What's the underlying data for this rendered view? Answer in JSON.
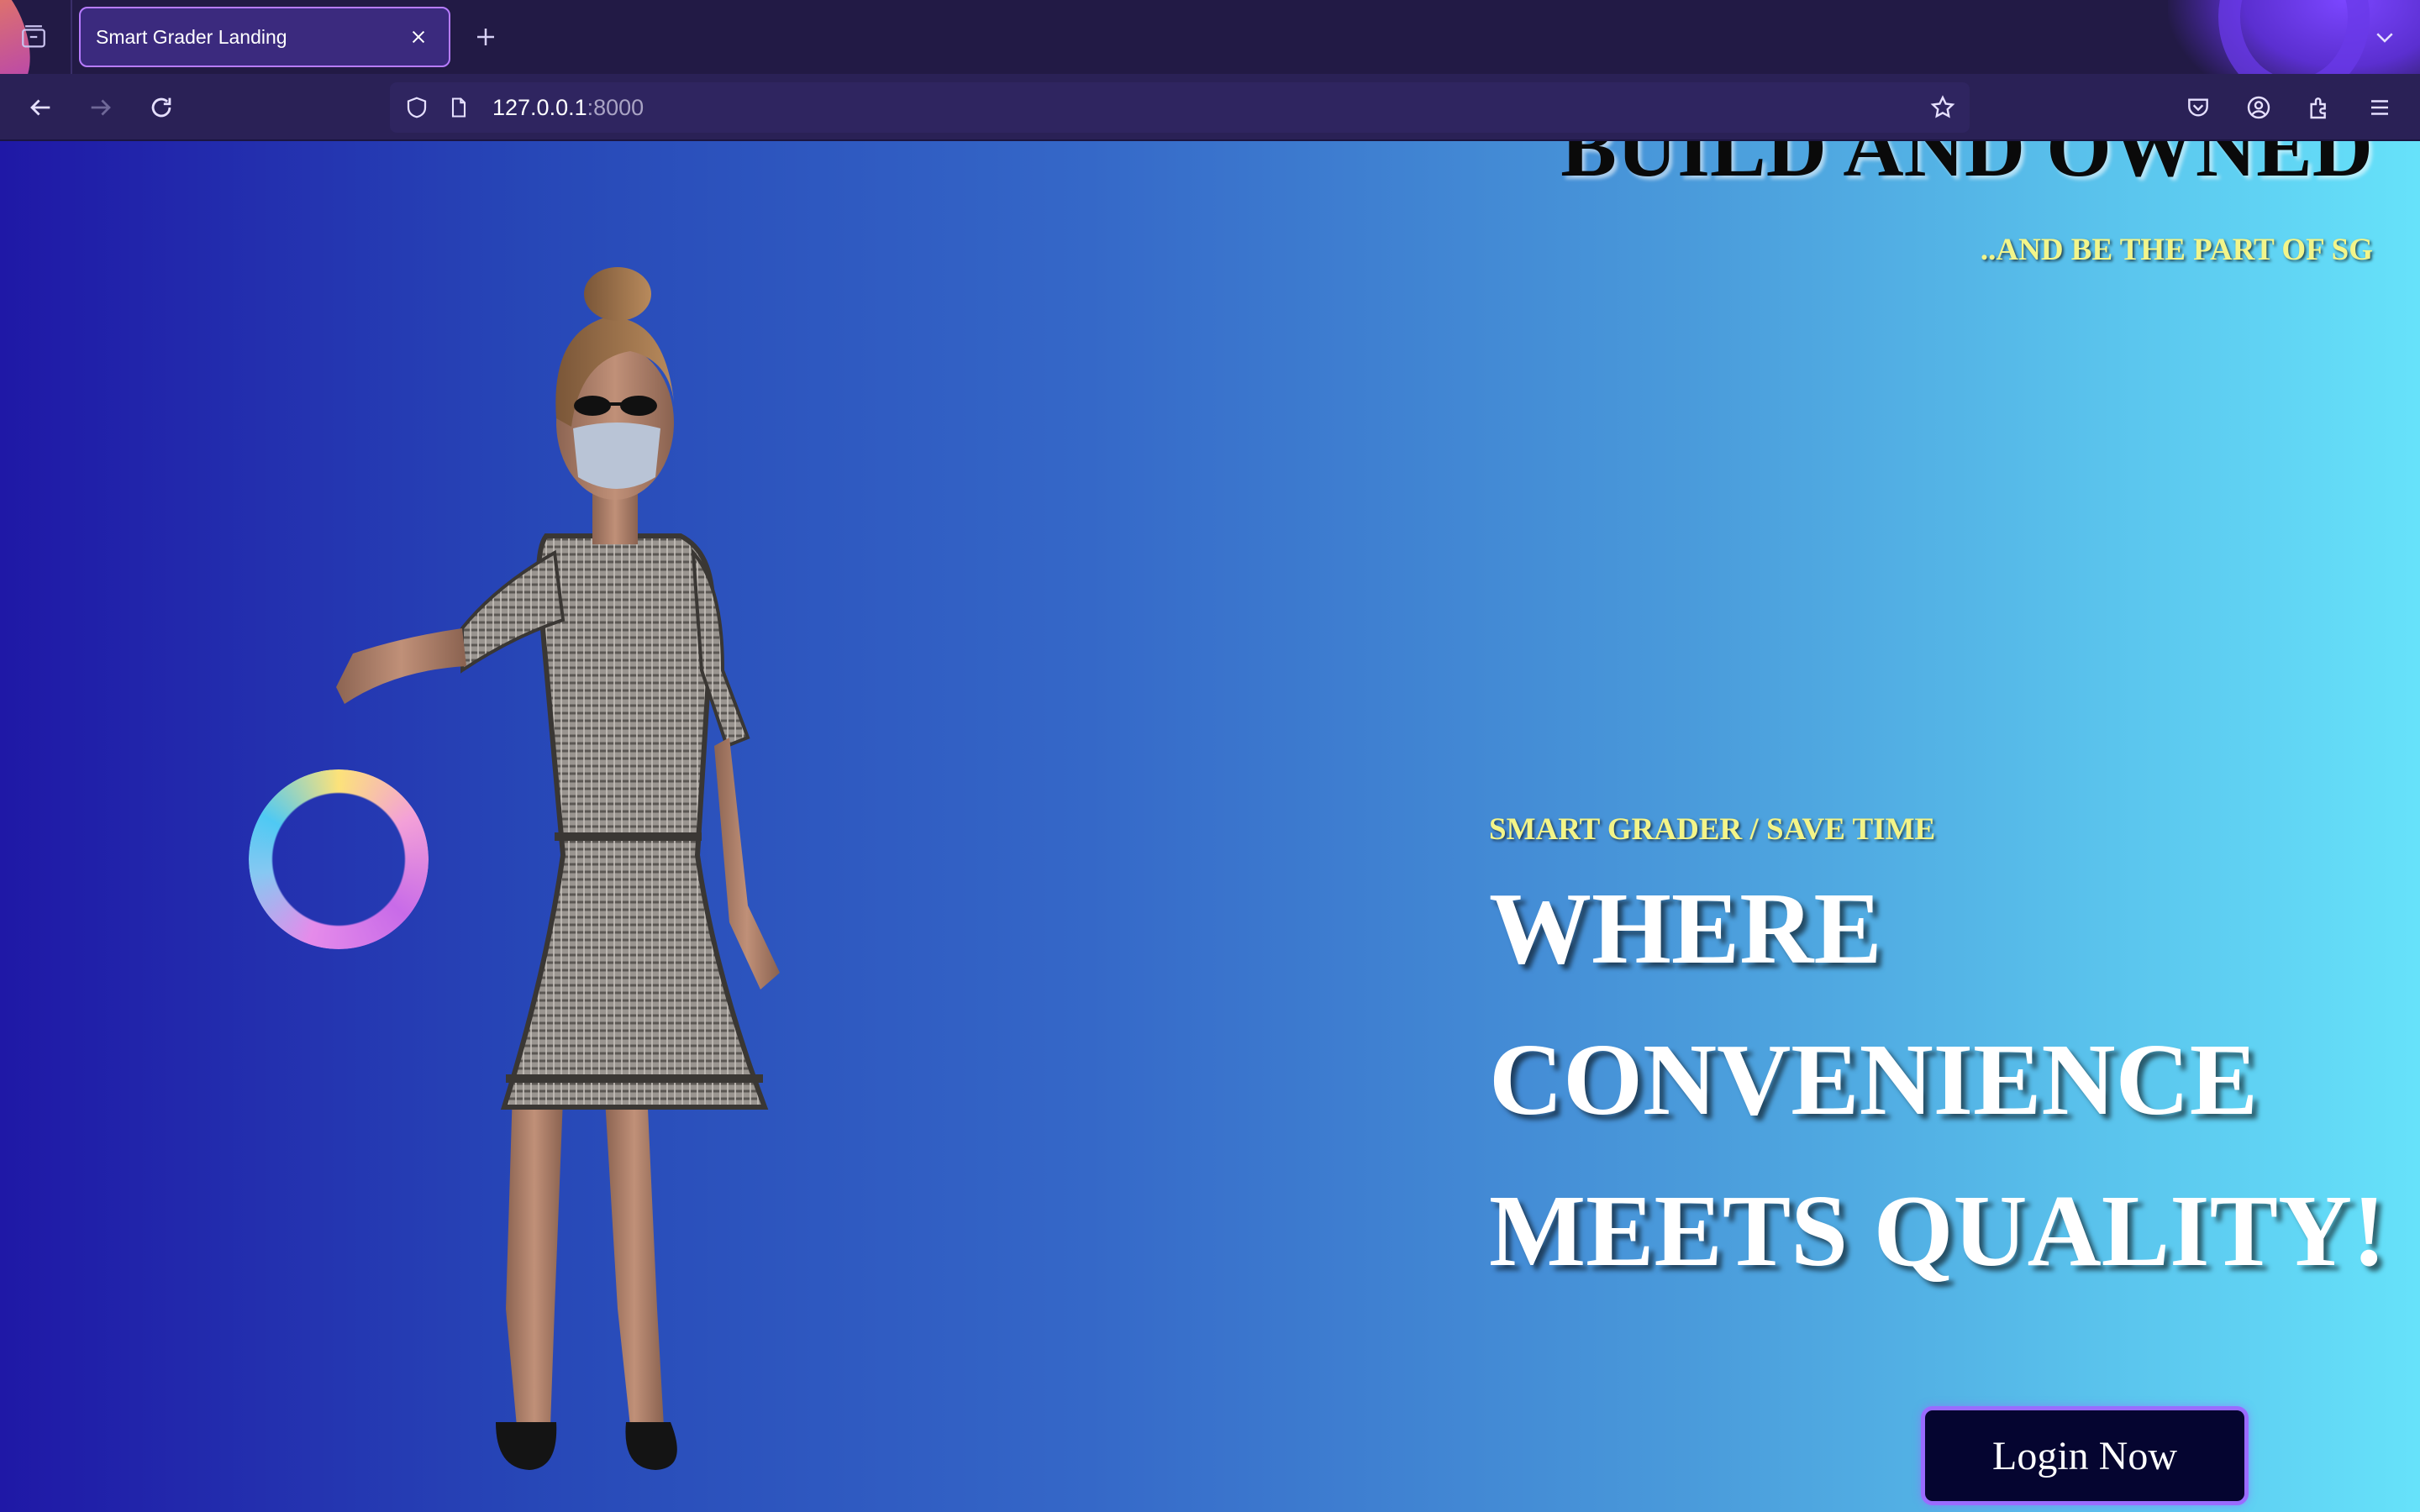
{
  "browser": {
    "tab": {
      "title": "Smart Grader Landing"
    },
    "url": {
      "host": "127.0.0.1",
      "port": ":8000"
    }
  },
  "page": {
    "hero_heading": "BUILD AND OWNED",
    "hero_subheading": "..AND BE THE PART OF SG",
    "tagline": "SMART GRADER / SAVE TIME",
    "headline_lines": [
      "WHERE",
      "CONVENIENCE",
      "MEETS QUALITY!"
    ],
    "login_button": "Login Now"
  },
  "icons": {
    "tab_list": "tab-list-icon",
    "tab_close": "close-icon",
    "new_tab": "plus-icon",
    "tab_overflow": "chevron-down-icon",
    "back": "back-arrow-icon",
    "forward": "forward-arrow-icon",
    "reload": "reload-icon",
    "shield": "shield-icon",
    "page": "page-icon",
    "bookmark": "star-icon",
    "pocket": "pocket-icon",
    "account": "account-icon",
    "extensions": "extensions-icon",
    "menu": "hamburger-menu-icon"
  },
  "colors": {
    "chrome_tabbar": "#221a45",
    "chrome_navbar": "#2a2156",
    "tab_accent": "#b77cff",
    "page_gradient_start": "#1f18a6",
    "page_gradient_end": "#66e2fa",
    "tagline": "#f3f488",
    "login_button_bg": "#050530",
    "login_button_border": "#9a6cff"
  }
}
